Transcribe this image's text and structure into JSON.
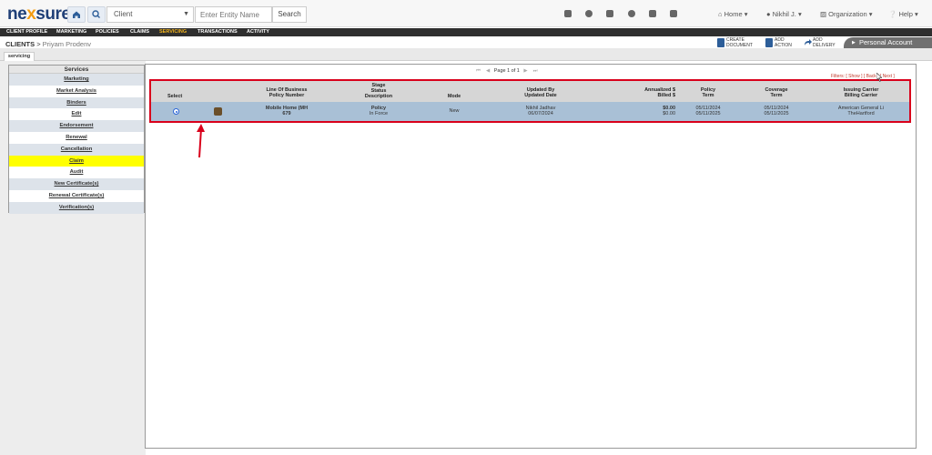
{
  "topbar": {
    "logo_left": "ne",
    "logo_x": "x",
    "logo_right": "sure",
    "client_select": "Client",
    "entity_placeholder": "Enter Entity Name",
    "search_label": "Search",
    "menus": [
      "Home",
      "Nikhil J.",
      "Organization",
      "Help"
    ]
  },
  "nav": {
    "items": [
      "CLIENT PROFILE",
      "MARKETING",
      "POLICIES",
      "CLAIMS",
      "SERVICING",
      "TRANSACTIONS",
      "ACTIVITY"
    ],
    "active": "SERVICING"
  },
  "breadcrumb": {
    "clients": "CLIENTS",
    "separator": ">",
    "client_name": "Priyam Prodenv"
  },
  "actions": {
    "create_document": [
      "CREATE",
      "DOCUMENT"
    ],
    "add_action": [
      "ADD",
      "ACTION"
    ],
    "add_delivery": [
      "ADD",
      "DELIVERY"
    ]
  },
  "personal_account": "Personal Account",
  "tab": "servicing",
  "services": {
    "header": "Services",
    "items": [
      "Marketing",
      "Market Analysis",
      "Binders",
      "Edit",
      "Endorsement",
      "Renewal",
      "Cancellation",
      "Claim",
      "Audit",
      "New Certificate(s)",
      "Renewal Certificate(s)",
      "Verification(s)"
    ]
  },
  "pager": {
    "first": "⏮",
    "prev": "◀",
    "label": "Page 1 of 1",
    "next": "▶",
    "last": "⏭"
  },
  "filters": "Filters: [ Show ] [ Back ] [ Next ]",
  "table": {
    "headers": {
      "select": "Select",
      "lob": [
        "Line Of Business",
        "Policy Number"
      ],
      "stage": [
        "Stage",
        "Status",
        "Description"
      ],
      "mode": "Mode",
      "updated": [
        "Updated By",
        "Updated Date"
      ],
      "annualized": [
        "Annualized $",
        "Billed $"
      ],
      "policy_term": [
        "Policy",
        "Term"
      ],
      "coverage_term": [
        "Coverage",
        "Term"
      ],
      "carrier": [
        "Issuing Carrier",
        "Billing Carrier"
      ]
    },
    "row": {
      "lob": [
        "Mobile Home (MH",
        "679"
      ],
      "stage": [
        "Policy",
        "In Force"
      ],
      "mode": "New",
      "updated": [
        "Nikhil Jadhav",
        "06/07/2024"
      ],
      "annualized": [
        "$0.00",
        "$0.00"
      ],
      "policy_term": [
        "05/11/2024",
        "05/11/2025"
      ],
      "coverage_term": [
        "05/11/2024",
        "05/11/2025"
      ],
      "carrier": [
        "American General Li",
        "TheHartford"
      ]
    }
  },
  "colors": {
    "nav_bg": "#2f2f2f",
    "nav_active": "#f1b31c",
    "highlight_border": "#d9001b",
    "row_selected": "#a9c0d6",
    "claim_highlight": "#ffff00"
  }
}
